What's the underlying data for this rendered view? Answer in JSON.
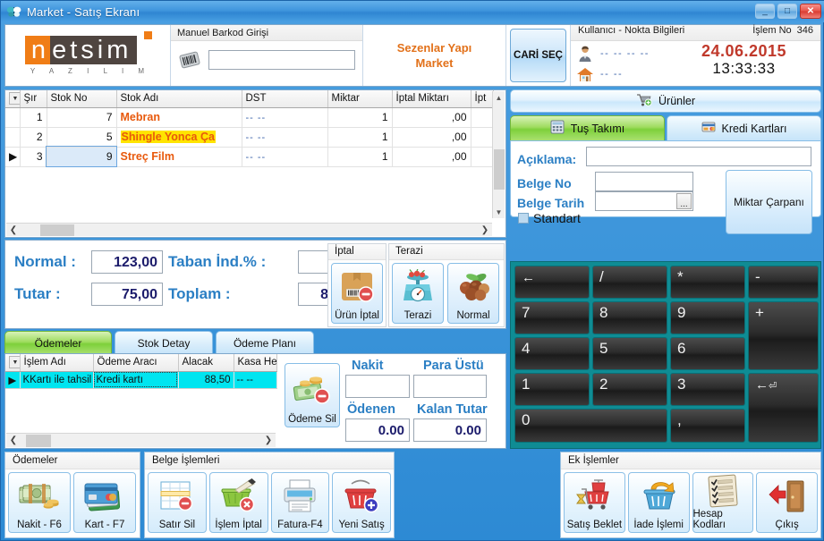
{
  "window": {
    "title": "Market - Satış Ekranı",
    "app_icon": "butterfly-icon",
    "minimize": "_",
    "maximize": "□",
    "close": "✕"
  },
  "header": {
    "logo": {
      "n": "n",
      "rest": "etsim",
      "sub": "Y A Z I L I M"
    },
    "barcode_group": {
      "caption": "Manuel Barkod Girişi",
      "icon": "barcode-icon",
      "value": "",
      "placeholder": ""
    },
    "market_name_line1": "Sezenlar Yapı",
    "market_name_line2": "Market",
    "cari_button": "CARİ SEÇ",
    "user_info": {
      "caption": "Kullanıcı - Nokta Bilgileri",
      "islem_no_label": "İşlem No",
      "islem_no_value": "346",
      "user_value": "-- -- -- --",
      "point_value": "-- --",
      "date": "24.06.2015",
      "time": "13:33:33"
    }
  },
  "items_grid": {
    "columns": [
      "Şır",
      "Stok No",
      "Stok Adı",
      "DST",
      "Miktar",
      "İptal Miktarı",
      "İpt"
    ],
    "rows": [
      {
        "sira": "1",
        "stok_no": "7",
        "stok_adi": "Mebran",
        "highlight": false,
        "dst": "-- --",
        "miktar": "1",
        "iptal_miktari": ",00",
        "ipt": ""
      },
      {
        "sira": "2",
        "stok_no": "5",
        "stok_adi": "Shingle Yonca Ça",
        "highlight": true,
        "dst": "-- --",
        "miktar": "1",
        "iptal_miktari": ",00",
        "ipt": ""
      },
      {
        "sira": "3",
        "stok_no": "9",
        "stok_adi": "Streç Film",
        "highlight": false,
        "dst": "-- --",
        "miktar": "1",
        "iptal_miktari": ",00",
        "ipt": ""
      }
    ]
  },
  "totals": {
    "normal_label": "Normal :",
    "normal_value": "123,00",
    "taban_label": "Taban İnd.% :",
    "taban_value": "",
    "tutar_label": "Tutar :",
    "tutar_value": "75,00",
    "toplam_label": "Toplam :",
    "toplam_value": "8"
  },
  "iptal_group": {
    "caption": "İptal",
    "button_label": "Ürün İptal",
    "button_icon": "box-cancel-icon"
  },
  "terazi_group": {
    "caption": "Terazi",
    "buttons": [
      {
        "label": "Terazi",
        "icon": "scale-icon"
      },
      {
        "label": "Normal",
        "icon": "nuts-icon"
      }
    ]
  },
  "tabs": [
    {
      "label": "Ödemeler",
      "active": true
    },
    {
      "label": "Stok Detay",
      "active": false
    },
    {
      "label": "Ödeme Planı",
      "active": false
    }
  ],
  "payments_grid": {
    "columns": [
      "İşlem Adı",
      "Ödeme Aracı",
      "Alacak",
      "Kasa He"
    ],
    "rows": [
      {
        "islem_adi": "KKartı ile tahsil",
        "odeme_araci": "Kredi kartı",
        "alacak": "88,50",
        "kasa": "-- --"
      }
    ]
  },
  "payment_actions": {
    "odeme_sil_label": "Ödeme Sil",
    "odeme_sil_icon": "money-cancel-icon"
  },
  "cash": {
    "nakit_label": "Nakit",
    "nakit_value": "",
    "para_ustu_label": "Para Üstü",
    "para_ustu_value": "",
    "odenen_label": "Ödenen",
    "odenen_value": "0.00",
    "kalan_label": "Kalan Tutar",
    "kalan_value": "0.00"
  },
  "right_panel": {
    "urunler_button": {
      "label": "Ürünler",
      "icon": "cart-add-icon"
    },
    "tabs": [
      {
        "label": "Tuş Takımı",
        "icon": "keypad-icon",
        "active": true
      },
      {
        "label": "Kredi Kartları",
        "icon": "creditcard-icon",
        "active": false
      }
    ],
    "form": {
      "aciklama_label": "Açıklama:",
      "aciklama_value": "",
      "belge_no_label": "Belge No",
      "belge_no_value": "",
      "belge_tarih_label": "Belge Tarih",
      "belge_tarih_value": "",
      "ellipsis": "...",
      "standart_label": "Standart",
      "standart_checked": false,
      "miktar_carpani_label": "Miktar Çarpanı"
    },
    "keypad": {
      "backspace": "←",
      "divide": "/",
      "multiply": "*",
      "minus": "-",
      "k7": "7",
      "k8": "8",
      "k9": "9",
      "plus": "+",
      "k4": "4",
      "k5": "5",
      "k6": "6",
      "k1": "1",
      "k2": "2",
      "k3": "3",
      "enter": "←",
      "k0": "0",
      "comma": ","
    }
  },
  "bottom_bars": [
    {
      "caption": "Ödemeler",
      "buttons": [
        {
          "label": "Nakit - F6",
          "icon": "cash-icon"
        },
        {
          "label": "Kart - F7",
          "icon": "card-icon"
        }
      ]
    },
    {
      "caption": "Belge İşlemleri",
      "buttons": [
        {
          "label": "Satır Sil",
          "icon": "row-delete-icon"
        },
        {
          "label": "İşlem İptal",
          "icon": "basket-cancel-icon"
        },
        {
          "label": "Fatura-F4",
          "icon": "printer-icon"
        },
        {
          "label": "Yeni Satış",
          "icon": "basket-add-icon"
        }
      ]
    },
    {
      "caption": "Ek İşlemler",
      "buttons": [
        {
          "label": "Satış Beklet",
          "icon": "cart-hold-icon"
        },
        {
          "label": "İade İşlemi",
          "icon": "basket-return-icon"
        },
        {
          "label": "Hesap Kodları",
          "icon": "checklist-icon"
        },
        {
          "label": "Çıkış",
          "icon": "exit-door-icon"
        }
      ]
    }
  ],
  "colors": {
    "window_blue": "#2d8ad4",
    "accent_orange": "#e8590c",
    "label_blue": "#2b7fc4",
    "value_navy": "#1b1b6b",
    "highlight_yellow": "#ffe400",
    "grid_selected_cyan": "#00e5f0",
    "date_red": "#c0392b",
    "tab_green": "#7ed03b",
    "keypad_teal": "#0f8c94"
  }
}
